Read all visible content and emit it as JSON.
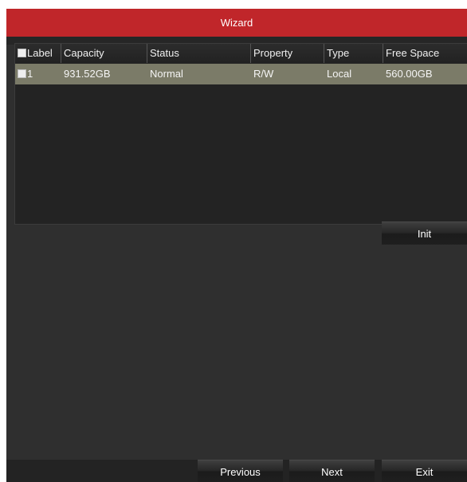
{
  "window": {
    "title": "Wizard"
  },
  "table": {
    "columns": [
      {
        "key": "label",
        "title": "Label"
      },
      {
        "key": "capacity",
        "title": "Capacity"
      },
      {
        "key": "status",
        "title": "Status"
      },
      {
        "key": "property",
        "title": "Property"
      },
      {
        "key": "type",
        "title": "Type"
      },
      {
        "key": "free_space",
        "title": "Free Space"
      }
    ],
    "rows": [
      {
        "label": "1",
        "capacity": "931.52GB",
        "status": "Normal",
        "property": "R/W",
        "type": "Local",
        "free_space": "560.00GB",
        "selected": true
      }
    ]
  },
  "actions": {
    "init": "Init"
  },
  "footer": {
    "previous": "Previous",
    "next": "Next",
    "exit": "Exit"
  },
  "colors": {
    "title_bar": "#c0262a",
    "selected_row": "#7b7b68",
    "background": "#2f2f2f"
  }
}
